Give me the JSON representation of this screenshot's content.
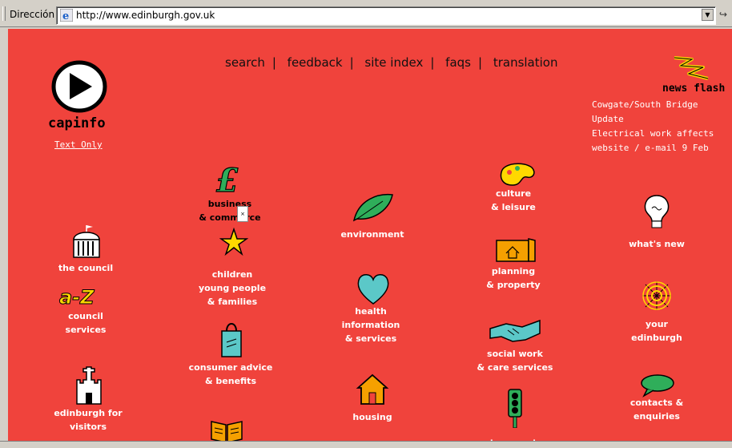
{
  "address_bar": {
    "label": "Dirección",
    "url": "http://www.edinburgh.gov.uk"
  },
  "top_nav": [
    "search",
    "feedback",
    "site index",
    "faqs",
    "translation"
  ],
  "top_nav_separator": "|",
  "logo": {
    "name": "capinfo",
    "text_only": "Text Only"
  },
  "news_flash": {
    "title": "news flash",
    "items": [
      "Cowgate/South Bridge Update",
      "Electrical work affects website / e-mail 9 Feb"
    ]
  },
  "sections": {
    "business": [
      "business",
      "& commerce"
    ],
    "children": [
      "children",
      "young people",
      "& families"
    ],
    "consumer": [
      "consumer advice",
      "& benefits"
    ],
    "environment": [
      "environment"
    ],
    "health": [
      "health",
      "information",
      "& services"
    ],
    "housing": [
      "housing"
    ],
    "culture": [
      "culture",
      "& leisure"
    ],
    "planning": [
      "planning",
      "& property"
    ],
    "social": [
      "social work",
      "& care services"
    ],
    "transport": [
      "transport"
    ],
    "council": [
      "the council"
    ],
    "az": [
      "council",
      "services"
    ],
    "visitors": [
      "edinburgh for",
      "visitors"
    ],
    "whatsnew": [
      "what's new"
    ],
    "your": [
      "your",
      "edinburgh"
    ],
    "contacts": [
      "contacts &",
      "enquiries"
    ]
  },
  "popup_close": "×",
  "colors": {
    "page_bg": "#f0433c",
    "link_white": "#ffffff",
    "chrome": "#d4d0c8"
  }
}
